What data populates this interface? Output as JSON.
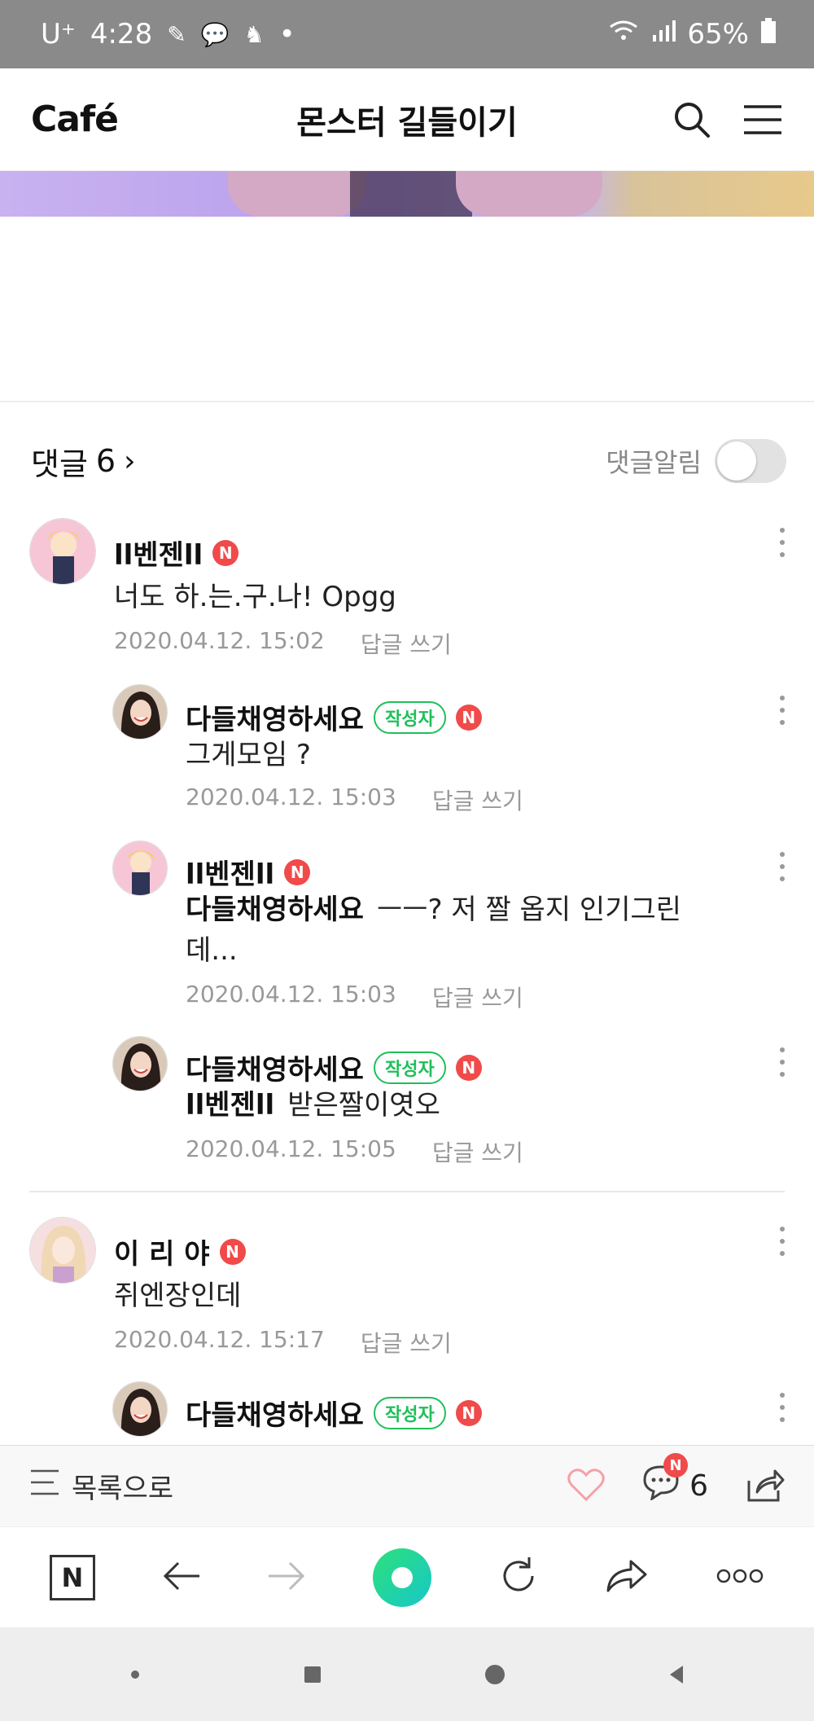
{
  "status_bar": {
    "carrier": "U⁺",
    "time": "4:28",
    "dot": "•",
    "battery": "65%"
  },
  "header": {
    "logo": "Café",
    "title": "몬스터 길들이기"
  },
  "comments_header": {
    "label": "댓글",
    "count": "6",
    "alert_label": "댓글알림",
    "alert_on": false
  },
  "comments": [
    {
      "author": "ll벤젠ll",
      "badge_n": "N",
      "text": "너도 하.는.구.나! Opgg",
      "date": "2020.04.12. 15:02",
      "reply": "답글 쓰기"
    },
    {
      "author": "다들채영하세요",
      "writer_badge": "작성자",
      "badge_n": "N",
      "text": "그게모임 ?",
      "date": "2020.04.12. 15:03",
      "reply": "답글 쓰기"
    },
    {
      "author": "ll벤젠ll",
      "badge_n": "N",
      "mention": "다들채영하세요",
      "text_line1": "ㅡㅡ? 저 짤 옵지 인기그린",
      "text_line2": "데...",
      "date": "2020.04.12. 15:03",
      "reply": "답글 쓰기"
    },
    {
      "author": "다들채영하세요",
      "writer_badge": "작성자",
      "badge_n": "N",
      "mention": "ll벤젠ll",
      "text": "받은짤이엿오",
      "date": "2020.04.12. 15:05",
      "reply": "답글 쓰기"
    },
    {
      "author": "이 리 야",
      "badge_n": "N",
      "text": "쥐엔장인데",
      "date": "2020.04.12. 15:17",
      "reply": "답글 쓰기"
    },
    {
      "author": "다들채영하세요",
      "writer_badge": "작성자",
      "badge_n": "N"
    }
  ],
  "cafe_bottom": {
    "list_label": "목록으로",
    "comment_count": "6",
    "comment_badge": "N"
  },
  "browser_bar": {
    "n_label": "N"
  },
  "colors": {
    "accent_green": "#1fbf5a",
    "badge_red": "#f04a4a",
    "heart_pink": "#f5a0a8"
  }
}
